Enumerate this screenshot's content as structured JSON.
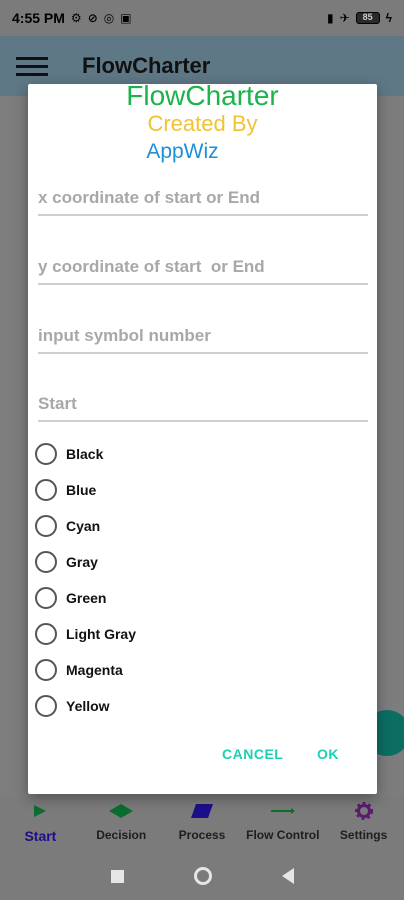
{
  "status_bar": {
    "time": "4:55 PM",
    "left_icons": [
      "settings-icon",
      "dnd-icon",
      "sync-icon",
      "signal-box-icon"
    ],
    "right_icons": [
      "signal-icon",
      "airplane-icon",
      "battery-icon",
      "charging-icon"
    ],
    "battery": "85"
  },
  "app_bar": {
    "title": "FlowCharter"
  },
  "dialog": {
    "title_app": "FlowCharter",
    "title_created": "Created By",
    "title_author": "AppWiz",
    "title_colors": {
      "app": "#1bb34a",
      "created": "#f2c230",
      "author": "#1e90d6"
    },
    "fields": {
      "x_placeholder": "x coordinate of start or End",
      "y_placeholder": "y coordinate of start  or End",
      "symbol_placeholder": "input symbol number",
      "label_placeholder": "Start",
      "x_value": "",
      "y_value": "",
      "symbol_value": "",
      "label_value": ""
    },
    "colors": [
      "Black",
      "Blue",
      "Cyan",
      "Gray",
      "Green",
      "Light Gray",
      "Magenta",
      "Yellow"
    ],
    "cancel_label": "CANCEL",
    "ok_label": "OK",
    "button_color": "#1bd0b3"
  },
  "bottom_nav": {
    "items": [
      {
        "label": "Start",
        "icon": "play-icon",
        "color": "#0b6d2e",
        "active": true
      },
      {
        "label": "Decision",
        "icon": "diamond-icon",
        "color": "#0b6d2e",
        "active": false
      },
      {
        "label": "Process",
        "icon": "parallelogram-icon",
        "color": "#1d0f8a",
        "active": false
      },
      {
        "label": "Flow Control",
        "icon": "arrow-right-icon",
        "color": "#0b6d2e",
        "active": false
      },
      {
        "label": "Settings",
        "icon": "gear-icon",
        "color": "#5a1a6e",
        "active": false
      }
    ]
  },
  "system_nav": {
    "icons": [
      "recents-icon",
      "home-icon",
      "back-icon"
    ]
  }
}
